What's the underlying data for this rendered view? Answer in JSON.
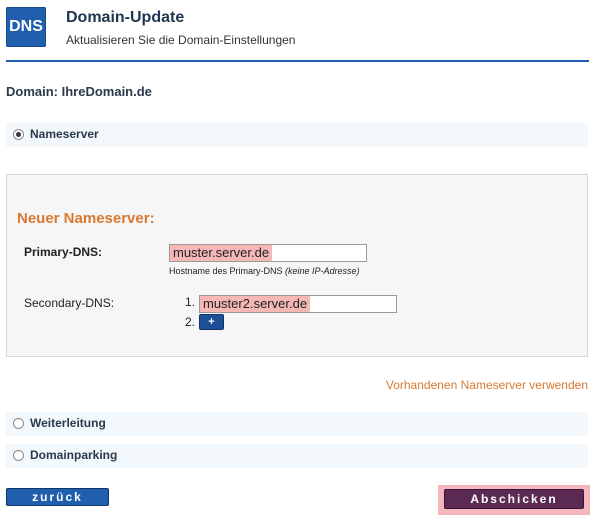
{
  "header": {
    "logo_text": "DNS",
    "title": "Domain-Update",
    "subtitle": "Aktualisieren Sie die Domain-Einstellungen"
  },
  "domain": {
    "label": "Domain: IhreDomain.de"
  },
  "options": {
    "nameserver": {
      "label": "Nameserver",
      "selected": true
    },
    "weiterleitung": {
      "label": "Weiterleitung",
      "selected": false
    },
    "domainparking": {
      "label": "Domainparking",
      "selected": false
    }
  },
  "panel": {
    "title": "Neuer Nameserver:",
    "primary": {
      "label": "Primary-DNS:",
      "value": "muster.server.de",
      "hint_prefix": "Hostname des Primary-DNS ",
      "hint_italic": "(keine IP-Adresse)"
    },
    "secondary": {
      "label": "Secondary-DNS:",
      "entries": [
        {
          "number": "1.",
          "value": "muster2.server.de"
        },
        {
          "number": "2.",
          "value": ""
        }
      ],
      "add_label": "+"
    }
  },
  "link": {
    "use_existing": "Vorhandenen Nameserver verwenden"
  },
  "buttons": {
    "back": "zurück",
    "submit": "Abschicken"
  },
  "colors": {
    "brand_blue": "#1f5fae",
    "accent_orange": "#d9792f",
    "submit_purple": "#5a2a52",
    "highlight_pink": "#f6b7b7"
  }
}
